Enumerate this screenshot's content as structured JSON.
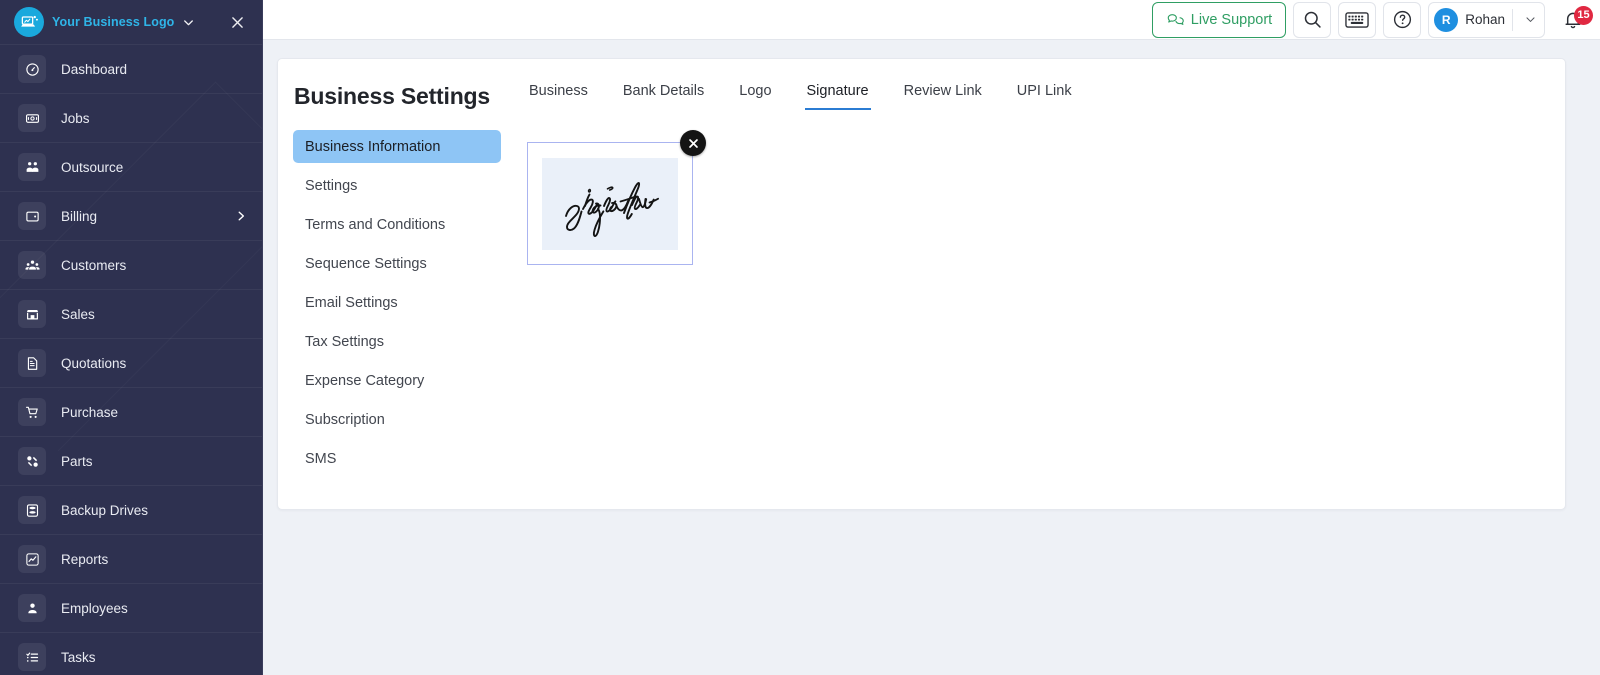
{
  "sidebar": {
    "brand": {
      "name": "Your Business Logo",
      "logo_icon": "laptop-chart-icon",
      "caret_icon": "chevron-down-icon",
      "close_icon": "close-icon",
      "logo_bg": "#1aa9dd",
      "text_color": "#2fb5e8"
    },
    "bg_color": "#2e3150",
    "items": [
      {
        "label": "Dashboard",
        "icon": "gauge-icon",
        "has_chevron": false
      },
      {
        "label": "Jobs",
        "icon": "ticket-icon",
        "has_chevron": false
      },
      {
        "label": "Outsource",
        "icon": "people-pair-icon",
        "has_chevron": false
      },
      {
        "label": "Billing",
        "icon": "wallet-icon",
        "has_chevron": true
      },
      {
        "label": "Customers",
        "icon": "users-group-icon",
        "has_chevron": false
      },
      {
        "label": "Sales",
        "icon": "store-icon",
        "has_chevron": false
      },
      {
        "label": "Quotations",
        "icon": "document-lines-icon",
        "has_chevron": false
      },
      {
        "label": "Purchase",
        "icon": "shopping-cart-icon",
        "has_chevron": false
      },
      {
        "label": "Parts",
        "icon": "gears-icon",
        "has_chevron": false
      },
      {
        "label": "Backup Drives",
        "icon": "database-icon",
        "has_chevron": false
      },
      {
        "label": "Reports",
        "icon": "line-chart-icon",
        "has_chevron": false
      },
      {
        "label": "Employees",
        "icon": "user-badge-icon",
        "has_chevron": false
      },
      {
        "label": "Tasks",
        "icon": "checklist-icon",
        "has_chevron": false
      }
    ]
  },
  "header": {
    "live_support": {
      "label": "Live Support",
      "icon": "chat-bubbles-icon",
      "color": "#2f9e63"
    },
    "search_icon": "search-icon",
    "keyboard_icon": "keyboard-icon",
    "help_icon": "help-circle-icon",
    "user": {
      "initial": "R",
      "name": "Rohan",
      "avatar_color": "#1f8fe0",
      "caret_icon": "chevron-down-icon"
    },
    "notifications": {
      "icon": "bell-icon",
      "count": "15",
      "badge_color": "#e02841"
    }
  },
  "panel": {
    "title": "Business Settings",
    "settings_menu": [
      {
        "label": "Business Information",
        "active": true
      },
      {
        "label": "Settings",
        "active": false
      },
      {
        "label": "Terms and Conditions",
        "active": false
      },
      {
        "label": "Sequence Settings",
        "active": false
      },
      {
        "label": "Email Settings",
        "active": false
      },
      {
        "label": "Tax Settings",
        "active": false
      },
      {
        "label": "Expense Category",
        "active": false
      },
      {
        "label": "Subscription",
        "active": false
      },
      {
        "label": "SMS",
        "active": false
      }
    ],
    "active_menu_color": "#8ec5f5",
    "tabs": [
      {
        "label": "Business",
        "active": false
      },
      {
        "label": "Bank Details",
        "active": false
      },
      {
        "label": "Logo",
        "active": false
      },
      {
        "label": "Signature",
        "active": true
      },
      {
        "label": "Review Link",
        "active": false
      },
      {
        "label": "UPI Link",
        "active": false
      }
    ],
    "active_tab_color": "#2b7cd3",
    "signature": {
      "alt": "Signature",
      "remove_icon": "close-circle-icon",
      "card_border_color": "#aab4f0",
      "image_bg": "#eaf0f9"
    }
  }
}
